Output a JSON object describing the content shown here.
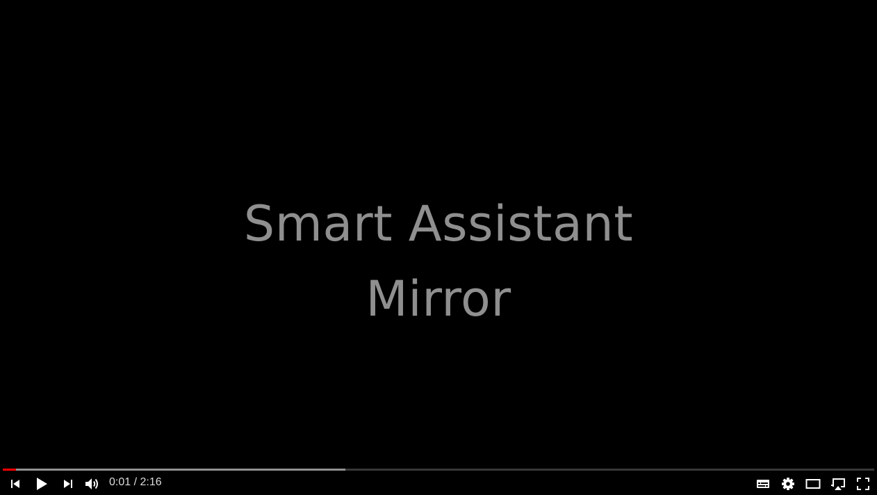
{
  "video": {
    "title_lines": [
      "Smart Assistant",
      "Mirror"
    ]
  },
  "progress": {
    "played_fraction": 0.015,
    "loaded_fraction": 0.393,
    "played_color": "#ff0000"
  },
  "controls": {
    "current_time": "0:01",
    "separator": " / ",
    "duration": "2:16",
    "icons": {
      "previous": "skip-previous-icon",
      "play": "play-icon",
      "next": "skip-next-icon",
      "volume": "volume-icon",
      "subtitles": "subtitles-icon",
      "settings": "gear-icon",
      "theater": "theater-mode-icon",
      "cast": "cast-icon",
      "fullscreen": "fullscreen-icon"
    }
  }
}
